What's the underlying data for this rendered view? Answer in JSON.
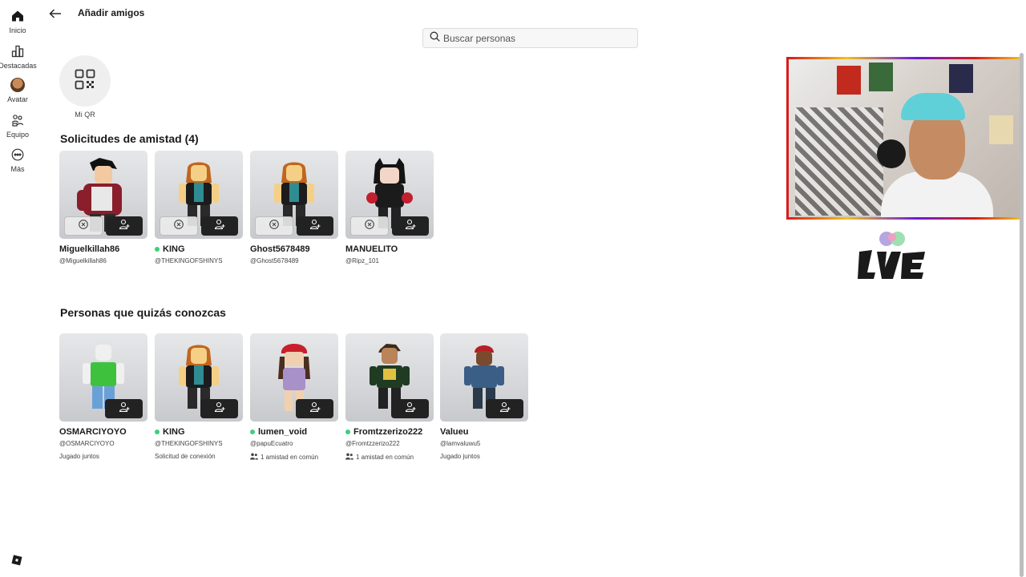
{
  "sidebar": {
    "items": [
      {
        "label": "Inicio",
        "icon": "home-icon"
      },
      {
        "label": "Destacadas",
        "icon": "chart-icon"
      },
      {
        "label": "Avatar",
        "icon": "avatar-icon"
      },
      {
        "label": "Equipo",
        "icon": "group-icon"
      },
      {
        "label": "Más",
        "icon": "more-icon"
      }
    ],
    "logo": "roblox-logo-icon"
  },
  "header": {
    "title": "Añadir amigos",
    "search_placeholder": "Buscar personas"
  },
  "qr": {
    "label": "Mi QR"
  },
  "requests": {
    "title": "Solicitudes de amistad (4)",
    "cards": [
      {
        "name": "Miguelkillah86",
        "handle": "@Miguelkillah86",
        "online": false
      },
      {
        "name": "KING",
        "handle": "@THEKINGOFSHINYS",
        "online": true
      },
      {
        "name": "Ghost5678489",
        "handle": "@Ghost5678489",
        "online": false
      },
      {
        "name": "MANUELITO",
        "handle": "@Ripz_101",
        "online": false
      }
    ]
  },
  "suggestions": {
    "title": "Personas que quizás conozcas",
    "cards": [
      {
        "name": "OSMARCIYOYO",
        "handle": "@OSMARCIYOYO",
        "meta": "Jugado juntos",
        "online": false,
        "meta_icon": false
      },
      {
        "name": "KING",
        "handle": "@THEKINGOFSHINYS",
        "meta": "Solicitud de conexión",
        "online": true,
        "meta_icon": false
      },
      {
        "name": "lumen_void",
        "handle": "@papuEcuatro",
        "meta": "1 amistad en común",
        "online": true,
        "meta_icon": true
      },
      {
        "name": "Fromtzzerizo222",
        "handle": "@Fromtzzerizo222",
        "meta": "1 amistad en común",
        "online": true,
        "meta_icon": true
      },
      {
        "name": "Valueu",
        "handle": "@lamvaluwu5",
        "meta": "Jugado juntos",
        "online": false,
        "meta_icon": false
      }
    ]
  },
  "colors": {
    "online": "#3ccf7a",
    "add_button": "#222222"
  }
}
